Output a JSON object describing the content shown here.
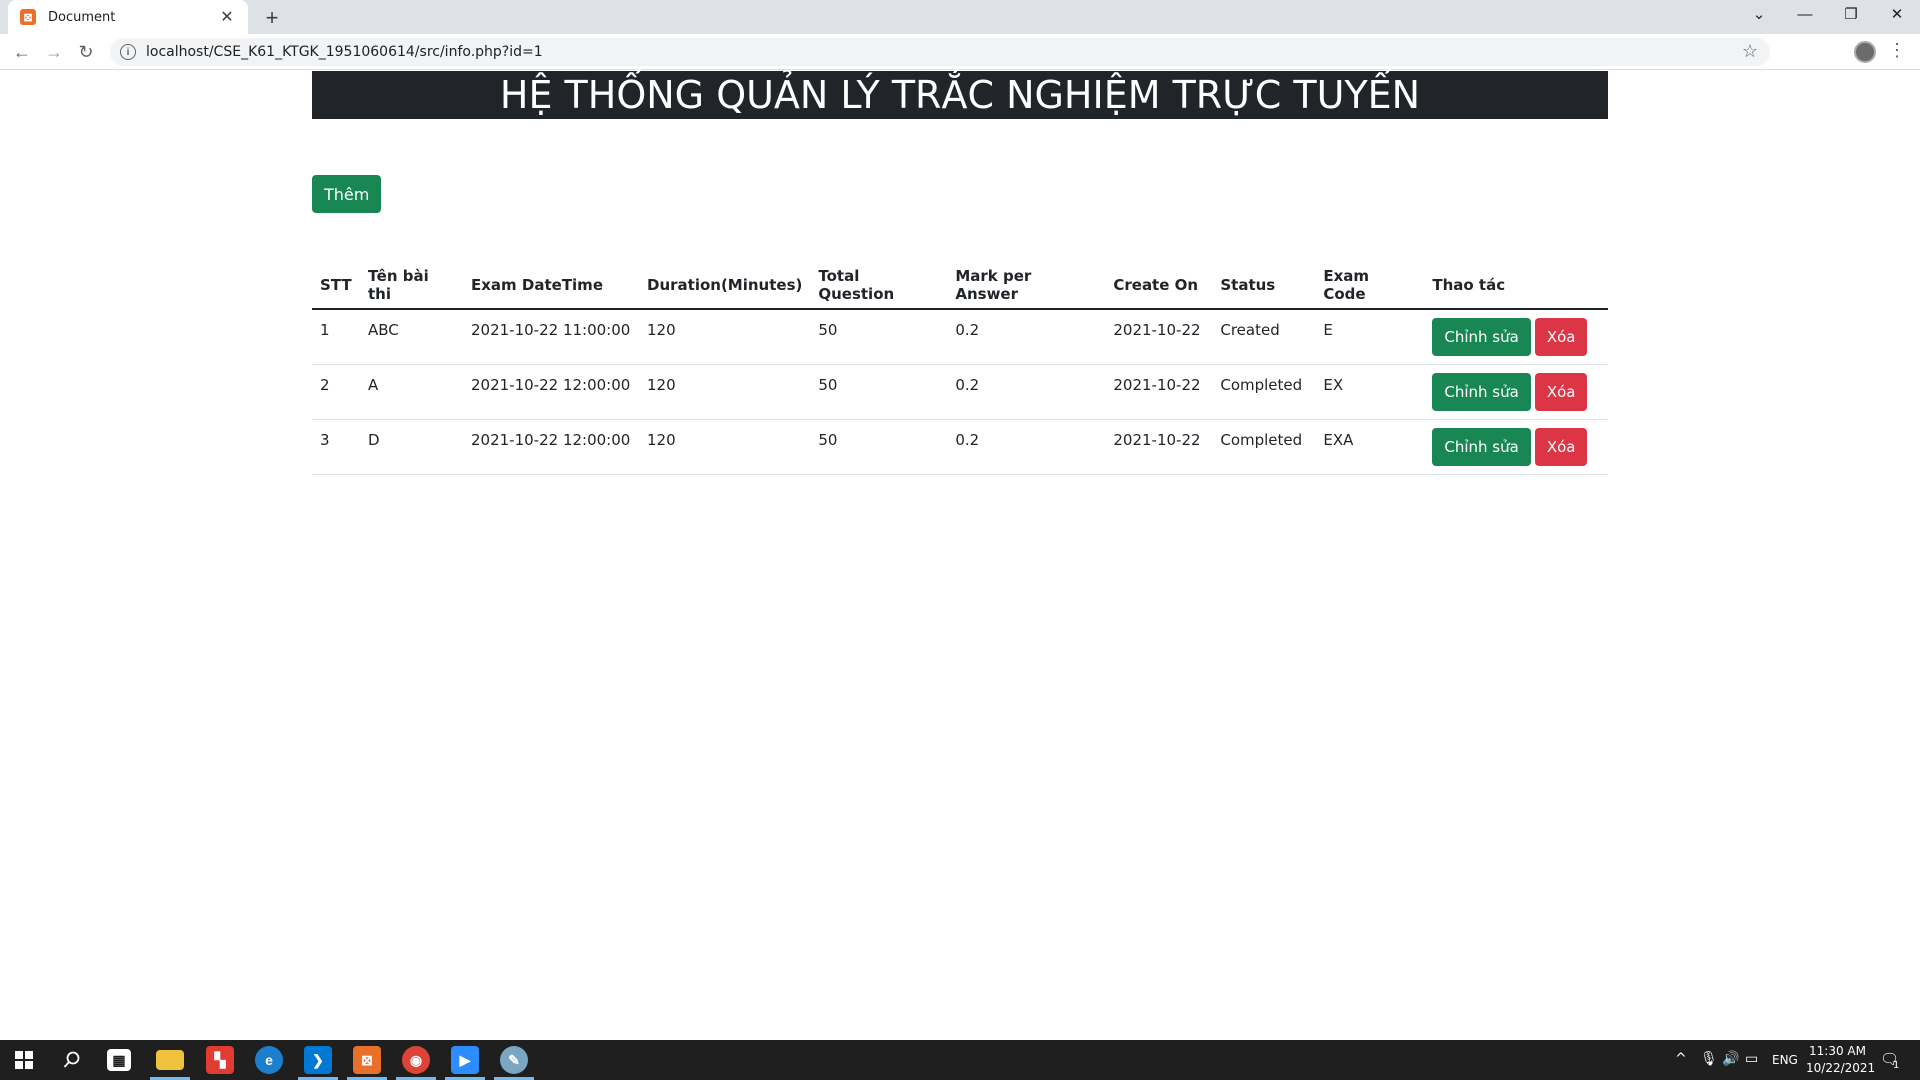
{
  "browser": {
    "tab_title": "Document",
    "tab_favicon": "xampp-icon",
    "url": "localhost/CSE_K61_KTGK_1951060614/src/info.php?id=1"
  },
  "page": {
    "header": "HỆ THỐNG QUẢN LÝ TRẮC NGHIỆM TRỰC TUYẾN",
    "add_button": "Thêm"
  },
  "table": {
    "headers": [
      "STT",
      "Tên bài thi",
      "Exam DateTime",
      "Duration(Minutes)",
      "Total Question",
      "Mark per Answer",
      "Create On",
      "Status",
      "Exam Code",
      "Thao tác"
    ],
    "rows": [
      {
        "stt": "1",
        "name": "ABC",
        "datetime": "2021-10-22 11:00:00",
        "duration": "120",
        "total": "50",
        "mark": "0.2",
        "created": "2021-10-22",
        "status": "Created",
        "code": "E",
        "edit": "Chỉnh sửa",
        "delete": "Xóa"
      },
      {
        "stt": "2",
        "name": "A",
        "datetime": "2021-10-22 12:00:00",
        "duration": "120",
        "total": "50",
        "mark": "0.2",
        "created": "2021-10-22",
        "status": "Completed",
        "code": "EX",
        "edit": "Chỉnh sửa",
        "delete": "Xóa"
      },
      {
        "stt": "3",
        "name": "D",
        "datetime": "2021-10-22 12:00:00",
        "duration": "120",
        "total": "50",
        "mark": "0.2",
        "created": "2021-10-22",
        "status": "Completed",
        "code": "EXA",
        "edit": "Chỉnh sửa",
        "delete": "Xóa"
      }
    ]
  },
  "taskbar": {
    "lang": "ENG",
    "time": "11:30 AM",
    "date": "10/22/2021",
    "notification_count": "1"
  },
  "colors": {
    "header_bg": "#212529",
    "success": "#198754",
    "danger": "#dc3545"
  }
}
